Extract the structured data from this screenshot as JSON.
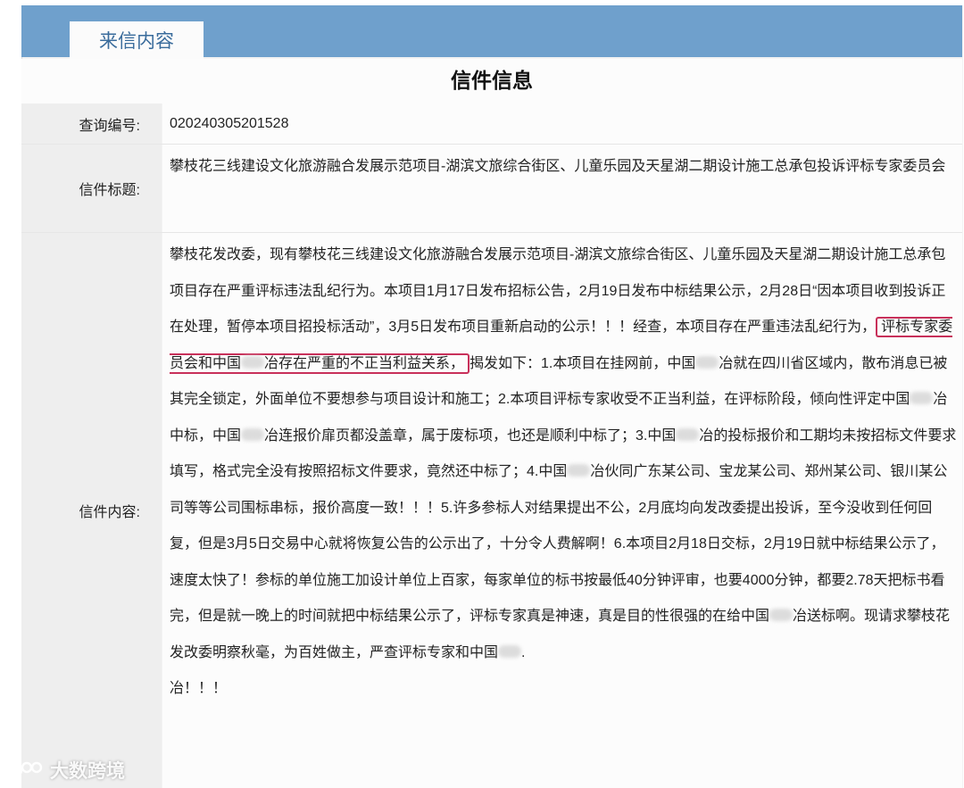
{
  "tab": {
    "label": "来信内容"
  },
  "page": {
    "title": "信件信息"
  },
  "fields": {
    "query_label": "查询编号:",
    "query_value": "020240305201528",
    "subject_label": "信件标题:",
    "subject_value": "攀枝花三线建设文化旅游融合发展示范项目-湖滨文旅综合街区、儿童乐园及天星湖二期设计施工总承包投诉评标专家委员会",
    "content_label": "信件内容:"
  },
  "content": {
    "p1": "攀枝花发改委，现有攀枝花三线建设文化旅游融合发展示范项目-湖滨文旅综合街区、儿童乐园及天星湖二期设计施工总承包项目存在严重评标违法乱纪行为。本项目1月17日发布招标公告，2月19日发布中标结果公示，2月28日“因本项目收到投诉正在处理，暂停本项目招投标活动”，3月5日发布项目重新启动的公示！！！经查，本项目存在严重违法乱纪行为，",
    "hl_a": "评标专家委员会和中国",
    "hl_b": "冶存在严重的不正当利益关系，",
    "p2": "揭发如下：1.本项目在挂网前，中国",
    "p3": "冶就在四川省区域内，散布消息已被其完全锁定，外面单位不要想参与项目设计和施工；2.本项目评标专家收受不正当利益，在评标阶段，倾向性评定中国",
    "p4": "冶中标，中国",
    "p5": "冶连报价扉页都没盖章，属于废标项，也还是顺利中标了；3.中国",
    "p6": "冶的投标报价和工期均未按招标文件要求填写，格式完全没有按照招标文件要求，竟然还中标了；4.中国",
    "p7": "冶伙同广东某公司、宝龙某公司、郑州某公司、银川某公司等等公司围标串标，报价高度一致！！！5.许多参标人对结果提出不公，2月底均向发改委提出投诉，至今没收到任何回复，但是3月5日交易中心就将恢复公告的公示出了，十分令人费解啊！6.本项目2月18日交标，2月19日就中标结果公示了，速度太快了！参标的单位施工加设计单位上百家，每家单位的标书按最低40分钟评审，也要4000分钟，都要2.78天把标书看完，但是就一晚上的时间就把中标结果公示了，评标专家真是神速，真是目的性很强的在给中国",
    "p8": "冶送标啊。现请求攀枝花发改委明察秋毫，为百姓做主，严查评标专家和中国",
    "p9": ".",
    "p10": "冶！！！"
  },
  "watermark": {
    "text": "大数跨境"
  }
}
